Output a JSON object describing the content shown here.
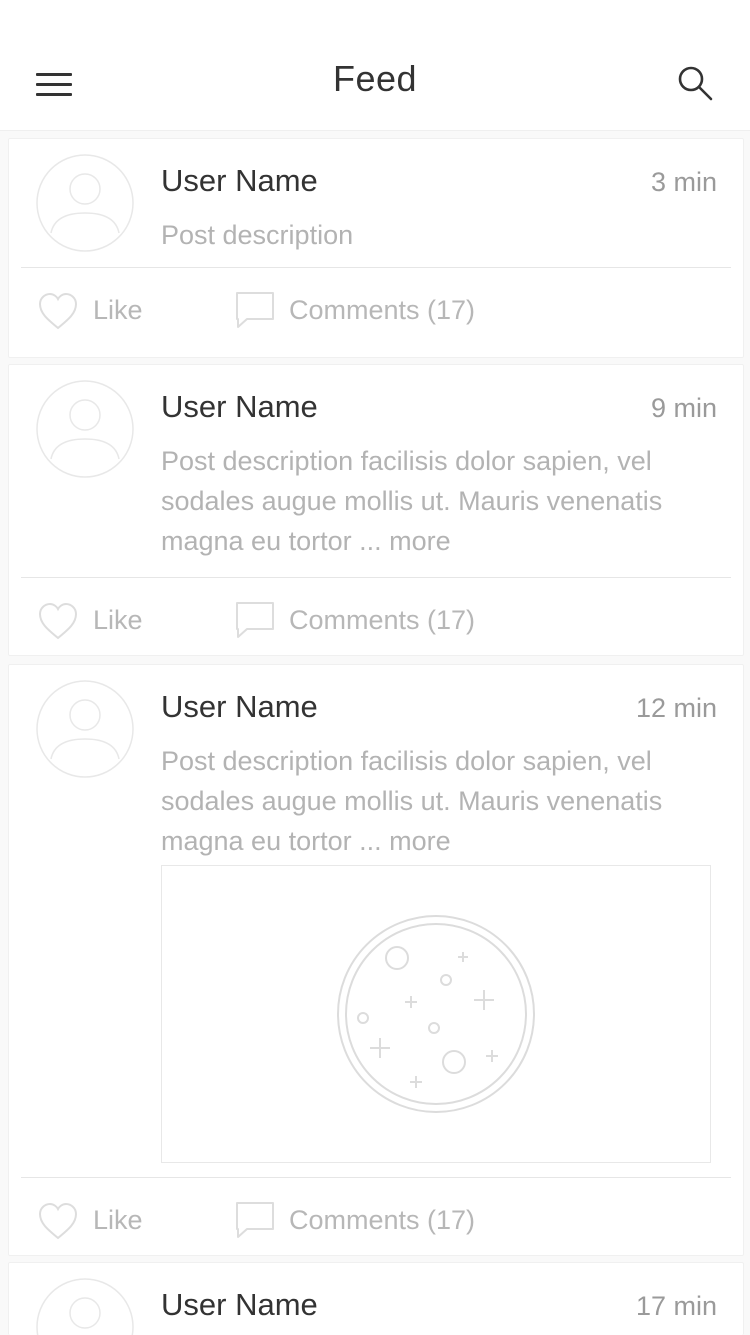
{
  "header": {
    "title": "Feed",
    "menu_icon": "hamburger-menu-icon",
    "search_icon": "search-icon"
  },
  "colors": {
    "text_primary": "#333333",
    "text_secondary": "#b3b3b3",
    "divider": "#e6e6e6",
    "icon_stroke": "#dddddd",
    "background": "#f9f9f9"
  },
  "posts": [
    {
      "user": "User Name",
      "time": "3 min",
      "description": "Post description",
      "like_label": "Like",
      "comments_label": "Comments (17)",
      "has_image": false
    },
    {
      "user": "User Name",
      "time": "9 min",
      "description": "Post description facilisis dolor sapien, vel sodales augue mollis ut. Mauris venenatis magna eu tortor ... more",
      "like_label": "Like",
      "comments_label": "Comments (17)",
      "has_image": false
    },
    {
      "user": "User Name",
      "time": "12 min",
      "description": "Post description facilisis dolor sapien, vel sodales augue mollis ut. Mauris venenatis magna eu tortor ... more",
      "like_label": "Like",
      "comments_label": "Comments (17)",
      "has_image": true,
      "image_icon": "image-placeholder-icon"
    },
    {
      "user": "User Name",
      "time": "17 min"
    }
  ]
}
